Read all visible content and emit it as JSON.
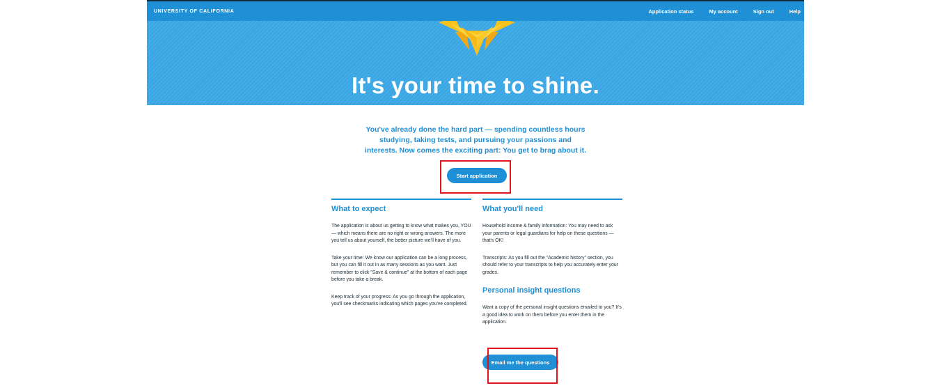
{
  "topbar": {
    "brand": "UNIVERSITY OF CALIFORNIA",
    "nav": [
      "Application status",
      "My account",
      "Sign out",
      "Help"
    ]
  },
  "hero": {
    "title": "It's your time to shine.",
    "icon": "sun-icon"
  },
  "intro": {
    "line1": "You've already done the hard part — spending countless hours",
    "line2": "studying, taking tests, and pursuing your passions and",
    "line3": "interests. Now comes the exciting part: You get to brag about it."
  },
  "buttons": {
    "start": "Start application",
    "email": "Email me the questions"
  },
  "expect": {
    "heading": "What to expect",
    "p1": "The application is about us getting to know what makes you, YOU — which means there are no right or wrong answers. The more you tell us about yourself, the better picture we'll have of you.",
    "p2": "Take your time: We know our application can be a long process, but you can fill it out in as many sessions as you want. Just remember to click \"Save & continue\" at the bottom of each page before you take a break.",
    "p3": "Keep track of your progress: As you go through the application, you'll see checkmarks indicating which pages you've completed."
  },
  "need": {
    "heading": "What you'll need",
    "p1": "Household income & family information: You may need to ask your parents or legal guardians for help on these questions — that's OK!",
    "p2": "Transcripts: As you fill out the \"Academic history\" section, you should refer to your transcripts to help you accurately enter your grades."
  },
  "piq": {
    "heading": "Personal insight questions",
    "p1": "Want a copy of the personal insight questions emailed to you? It's a good idea to work on them before you enter them in the application."
  },
  "colors": {
    "brand_blue": "#1f8fd6",
    "hero_blue": "#3aa6e4",
    "sun_yellow": "#f7c21e",
    "highlight_red": "#e0141c"
  }
}
